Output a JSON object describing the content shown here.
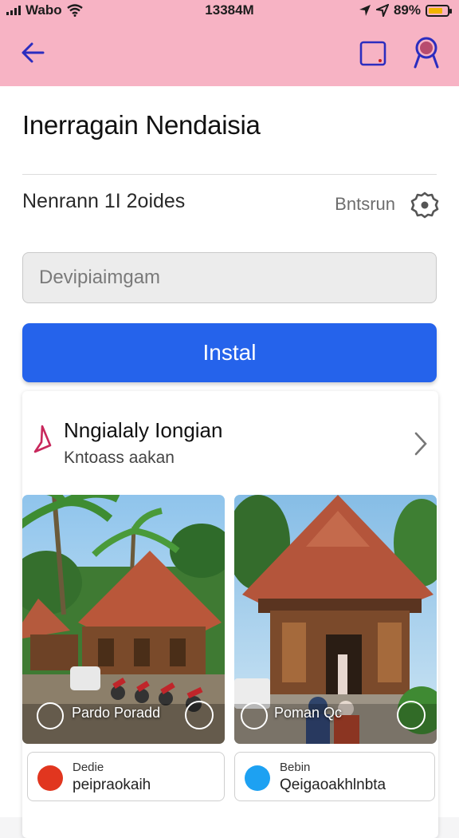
{
  "status_bar": {
    "carrier": "Wabo",
    "time": "13384M",
    "battery": "89%",
    "battery_level": 0.75
  },
  "app_bar": {
    "back_icon": "arrow-left-icon",
    "square_icon": "square-icon",
    "user_icon": "user-icon",
    "accent": "#2b2dbf",
    "background": "#f7b3c4"
  },
  "page": {
    "title": "Inerragain Nendaisia",
    "subtitle": "Nenrann 1I 2oides",
    "option_label": "Bntsrun",
    "settings_icon": "eye-settings-icon"
  },
  "search": {
    "placeholder": "Devipiaimgam"
  },
  "install": {
    "label": "Instal",
    "color": "#2563eb"
  },
  "list_item": {
    "title": "Nngialaly Iongian",
    "subtitle": "Kntoass aakan",
    "icon": "pin-icon"
  },
  "photos": [
    {
      "caption": "Pardo Poradd",
      "icon": "compass-icon"
    },
    {
      "caption": "Poman Qc",
      "icon": "share-icon"
    }
  ],
  "tiles": [
    {
      "top": "Dedie",
      "bottom": "peipraokaih",
      "icon": "flag-icon"
    },
    {
      "top": "Bebin",
      "bottom": "Qeigaoakhlnbta",
      "icon": "twitter-icon"
    }
  ]
}
